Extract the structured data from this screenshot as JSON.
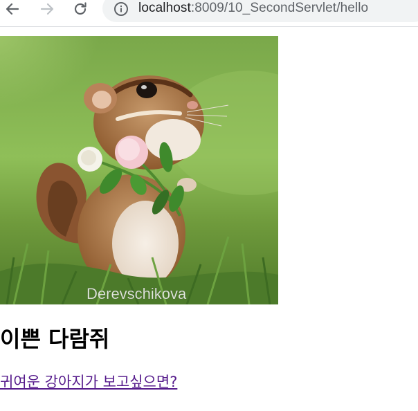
{
  "browser": {
    "url_host": "localhost",
    "url_path": ":8009/10_SecondServlet/hello",
    "icons": {
      "back": "back-arrow-icon",
      "forward": "forward-arrow-icon",
      "reload": "reload-icon",
      "site_info": "info-icon"
    }
  },
  "page": {
    "image_watermark": "Derevschikova",
    "heading": "이쁜 다람쥐",
    "link_text": "귀여운 강아지가 보고싶으면?",
    "colors": {
      "link_visited": "#551a8b",
      "heading": "#000000"
    }
  }
}
